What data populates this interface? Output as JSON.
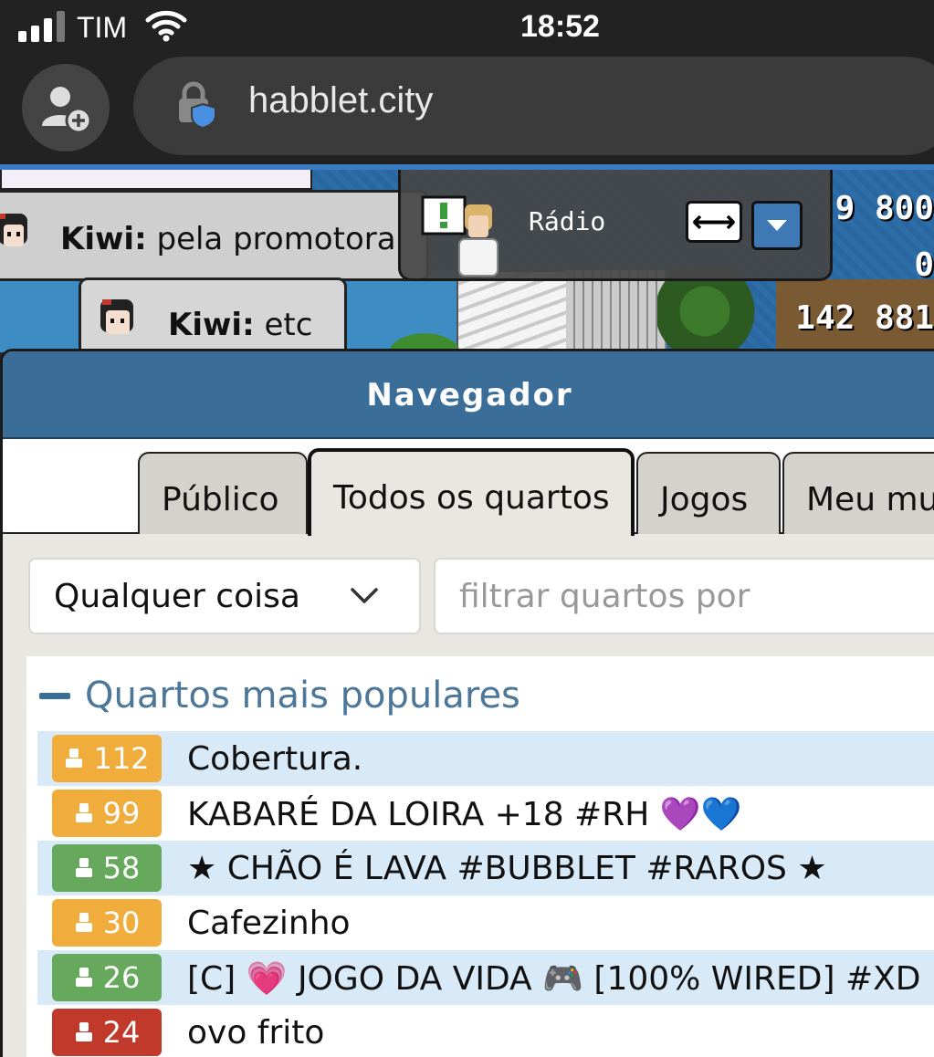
{
  "status_bar": {
    "carrier": "TIM",
    "time": "18:52",
    "signal_bars": 3
  },
  "browser": {
    "url": "habblet.city"
  },
  "game": {
    "chat": [
      {
        "user": "Kiwi:",
        "message": "pela promotora"
      },
      {
        "user": "Kiwi:",
        "message": "etc"
      }
    ],
    "radio_label": "Rádio",
    "radio_toggle": "⟷",
    "hud": [
      "9 800",
      "0",
      "142 881"
    ]
  },
  "navigator": {
    "title": "Navegador",
    "tabs": [
      {
        "label": "Público",
        "active": false
      },
      {
        "label": "Todos os quartos",
        "active": true
      },
      {
        "label": "Jogos",
        "active": false
      },
      {
        "label": "Meu mundo",
        "active": false
      }
    ],
    "filter_select": "Qualquer coisa",
    "search_placeholder": "filtrar quartos por",
    "section_title": "Quartos mais populares",
    "rooms": [
      {
        "count": "112",
        "name": "Cobertura.",
        "color": "#f0ad3c"
      },
      {
        "count": "99",
        "name": "KABARÉ DA LOIRA +18 #RH 💜💙",
        "color": "#f0ad3c"
      },
      {
        "count": "58",
        "name": "★ CHÃO É LAVA #BUBBLET #RAROS ★",
        "color": "#66a85c"
      },
      {
        "count": "30",
        "name": "Cafezinho",
        "color": "#f0ad3c"
      },
      {
        "count": "26",
        "name": "[C] 💗 JOGO DA VIDA 🎮 [100% WIRED] #XD",
        "color": "#66a85c"
      },
      {
        "count": "24",
        "name": "ovo frito",
        "color": "#c0392b"
      }
    ]
  }
}
